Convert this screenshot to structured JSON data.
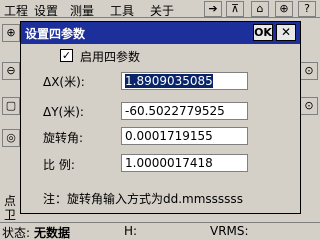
{
  "menu": [
    "工程",
    "设置",
    "测量",
    "工具",
    "关于"
  ],
  "toolbar_icons": [
    "arrow-right-icon",
    "tripod-icon",
    "house-icon",
    "gps-icon",
    "help-icon"
  ],
  "toolbar_glyphs": [
    "➔",
    "⊼",
    "⌂",
    "⊕",
    "?"
  ],
  "background": {
    "left_text_1": "点",
    "left_text_2": "卫",
    "status_label": "状态:",
    "status_value": "无数据",
    "h_label": "H:",
    "vrms_label": "VRMS:"
  },
  "dialog": {
    "title": "设置四参数",
    "ok_label": "OK",
    "close_glyph": "✕",
    "checkbox_label": "启用四参数",
    "checkbox_checked": true,
    "check_glyph": "✓",
    "rows": [
      {
        "label": "ΔX(米):",
        "value": "1.8909035085"
      },
      {
        "label": "ΔY(米):",
        "value": "-60.5022779525"
      },
      {
        "label": "旋转角:",
        "value": "0.0001719155"
      },
      {
        "label": "比  例:",
        "value": "1.0000017418"
      }
    ],
    "note": "注：旋转角输入方式为dd.mmssssss"
  },
  "colors": {
    "titlebar": "#1d2f9a",
    "selection": "#0a246a",
    "window_bg": "#d4d0c8"
  }
}
